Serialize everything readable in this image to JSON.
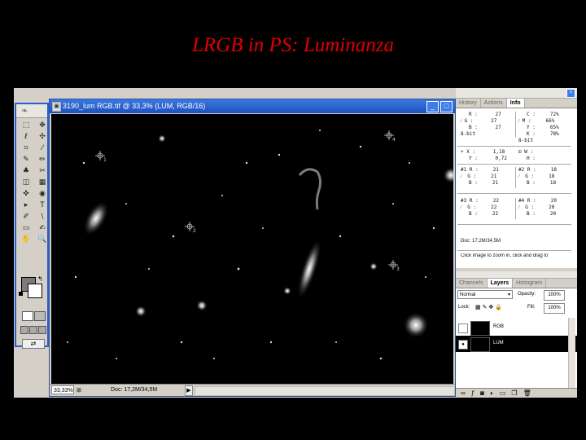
{
  "slide": {
    "title": "LRGB in PS: Luminanza"
  },
  "toolbox": {
    "tools": [
      "⬚",
      "✥",
      "ℓ",
      "✣",
      "⌗",
      "⁄",
      "✎",
      "✏",
      "♣",
      "✂",
      "◫",
      "▦",
      "✜",
      "◉",
      "▸",
      "T",
      "✐",
      "\\",
      "▭",
      "✍",
      "✋",
      "🔍"
    ]
  },
  "document": {
    "title": "3190_lum RGB.tif @ 33,3% (LUM, RGB/16)",
    "zoom": "33,33%",
    "doc_size": "Doc: 17,2M/34,5M",
    "min": "_",
    "max": "□",
    "close": "×"
  },
  "canvas_labels": [
    "1",
    "2",
    "3",
    "4"
  ],
  "info_panel": {
    "tabs": [
      "History",
      "Actions",
      "Info"
    ],
    "active_tab": "Info",
    "rgb": {
      "R": "27",
      "G": "27",
      "B": "27"
    },
    "cmyk": {
      "C": "72%",
      "M": "66%",
      "Y": "65%",
      "K": "78%"
    },
    "bit_left": "8-bit",
    "bit_right": "8-bit",
    "xy": {
      "X": "1,18",
      "Y": "0,72"
    },
    "wh": {
      "W": "",
      "H": ""
    },
    "samplers": [
      {
        "label": "#1",
        "R": "21",
        "G": "21",
        "B": "21"
      },
      {
        "label": "#2",
        "R": "18",
        "G": "18",
        "B": "18"
      },
      {
        "label": "#3",
        "R": "22",
        "G": "22",
        "B": "22"
      },
      {
        "label": "#4",
        "R": "20",
        "G": "20",
        "B": "20"
      }
    ],
    "doc": "Doc: 17,2M/34,5M",
    "hint": "Click image to zoom in, click and drag to"
  },
  "layers_panel": {
    "tabs": [
      "Channels",
      "Layers",
      "Histogram"
    ],
    "active_tab": "Layers",
    "blend_mode": "Normal",
    "opacity_label": "Opacity:",
    "opacity": "100%",
    "lock_label": "Lock:",
    "fill_label": "Fill:",
    "fill": "100%",
    "layers": [
      {
        "name": "RGB",
        "visible": false,
        "selected": false
      },
      {
        "name": "LUM",
        "visible": true,
        "selected": true
      }
    ]
  }
}
